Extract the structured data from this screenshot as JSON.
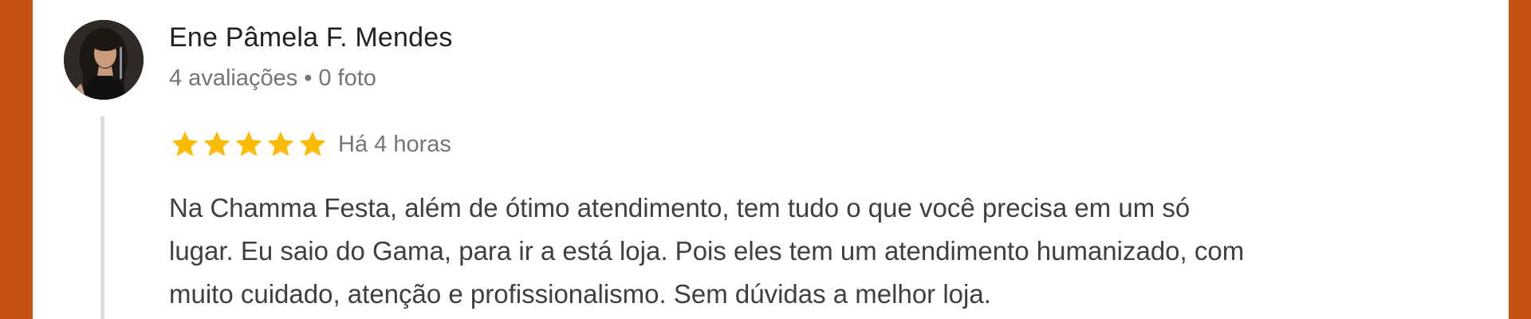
{
  "review": {
    "reviewer": {
      "name": "Ene Pâmela F. Mendes",
      "review_count": "4 avaliações",
      "separator": "•",
      "photo_count": "0 foto"
    },
    "rating": 5,
    "rating_max": 5,
    "star_icon": "star-icon",
    "time_ago": "Há 4 horas",
    "text_lines": [
      "Na Chamma Festa, além de ótimo atendimento, tem tudo o que você precisa em um só",
      "lugar. Eu saio do Gama, para ir a está loja. Pois eles tem um atendimento humanizado, com",
      "muito cuidado, atenção e profissionalismo. Sem dúvidas a melhor loja."
    ]
  },
  "colors": {
    "border": "#c8520f",
    "card": "#ffffff",
    "star": "#fbbc04",
    "name": "#202124",
    "meta": "#70757a",
    "body_text": "#3c4043",
    "thread_line": "#dadce0"
  }
}
